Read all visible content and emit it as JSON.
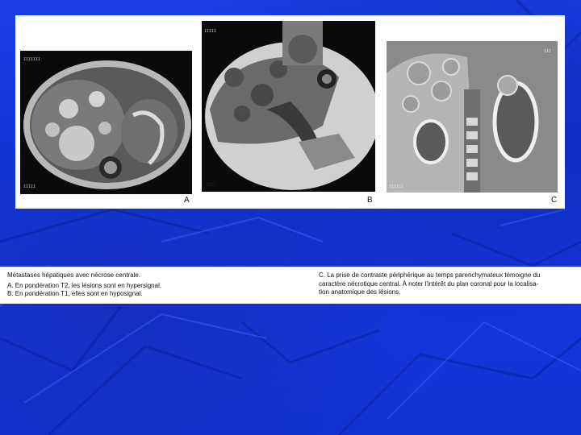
{
  "figure": {
    "labels": {
      "a": "A",
      "b": "B",
      "c": "C"
    }
  },
  "caption": {
    "left": {
      "title": "Métastases hépatiques avec nécrose centrale.",
      "line_a": "A. En pondération T2, les lésions sont en hypersignal.",
      "line_b": "B. En pondération T1, elles sont en hyposignal."
    },
    "right": {
      "line_1": "C. La prise de contraste périphérique au temps parenchymateux témoigne du",
      "line_2": "caractère nécrotique central. À noter l'intérêt du plan coronal pour la localisa-",
      "line_3": "tion anatomique des lésions."
    }
  }
}
